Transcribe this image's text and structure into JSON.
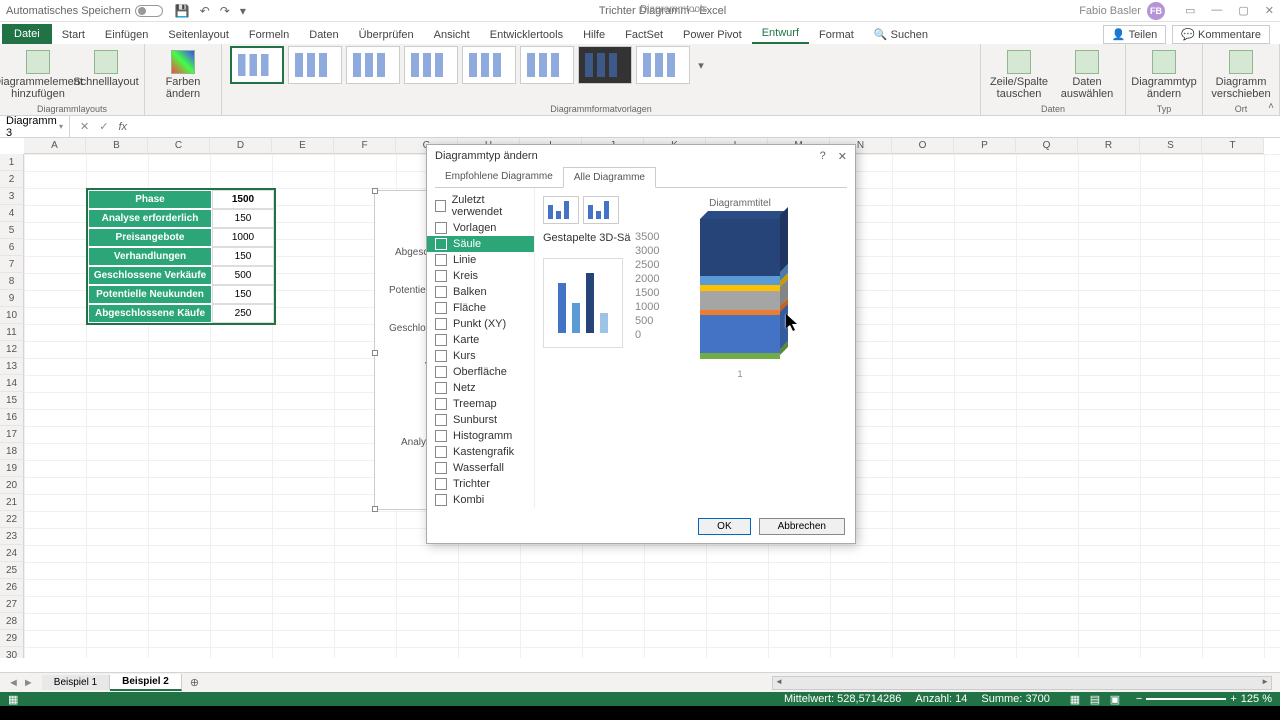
{
  "titlebar": {
    "autosave": "Automatisches Speichern",
    "doc_title": "Trichter Diagramm - Excel",
    "context_tools": "Diagrammtools",
    "user_name": "Fabio Basler",
    "user_initials": "FB"
  },
  "tabs": {
    "file": "Datei",
    "items": [
      "Start",
      "Einfügen",
      "Seitenlayout",
      "Formeln",
      "Daten",
      "Überprüfen",
      "Ansicht",
      "Entwicklertools",
      "Hilfe",
      "FactSet",
      "Power Pivot",
      "Entwurf",
      "Format"
    ],
    "active": "Entwurf",
    "search": "Suchen",
    "share": "Teilen",
    "comments": "Kommentare"
  },
  "ribbon": {
    "layouts": {
      "add_element": "Diagrammelement hinzufügen",
      "quick": "Schnelllayout",
      "label": "Diagrammlayouts"
    },
    "colors": {
      "btn": "Farben ändern"
    },
    "styles_label": "Diagrammformatvorlagen",
    "data": {
      "switch": "Zeile/Spalte tauschen",
      "select": "Daten auswählen",
      "label": "Daten"
    },
    "type": {
      "change": "Diagrammtyp ändern",
      "label": "Typ"
    },
    "location": {
      "move": "Diagramm verschieben",
      "label": "Ort"
    }
  },
  "namebox": "Diagramm 3",
  "columns": [
    "A",
    "B",
    "C",
    "D",
    "E",
    "F",
    "G",
    "H",
    "I",
    "J",
    "K",
    "L",
    "M",
    "N",
    "O",
    "P",
    "Q",
    "R",
    "S",
    "T"
  ],
  "rows_count": 30,
  "data_table": {
    "header": [
      "Phase",
      "1500"
    ],
    "rows": [
      [
        "Analyse erforderlich",
        "150"
      ],
      [
        "Preisangebote",
        "1000"
      ],
      [
        "Verhandlungen",
        "150"
      ],
      [
        "Geschlossene Verkäufe",
        "500"
      ],
      [
        "Potentielle Neukunden",
        "150"
      ],
      [
        "Abgeschlossene Käufe",
        "250"
      ]
    ]
  },
  "chart_back_labels": [
    "Abgeschlossen",
    "Potentielle Neu",
    "Geschlossene V",
    "Verhand",
    "Preisa",
    "Analyse erfo"
  ],
  "dialog": {
    "title": "Diagrammtyp ändern",
    "help": "?",
    "tab_recommended": "Empfohlene Diagramme",
    "tab_all": "Alle Diagramme",
    "types": [
      "Zuletzt verwendet",
      "Vorlagen",
      "Säule",
      "Linie",
      "Kreis",
      "Balken",
      "Fläche",
      "Punkt (XY)",
      "Karte",
      "Kurs",
      "Oberfläche",
      "Netz",
      "Treemap",
      "Sunburst",
      "Histogramm",
      "Kastengrafik",
      "Wasserfall",
      "Trichter",
      "Kombi"
    ],
    "selected_type": "Säule",
    "subtype_name": "Gestapelte 3D-Sä",
    "preview_title": "Diagrammtitel",
    "axis_ticks": [
      "3500",
      "3000",
      "2500",
      "2000",
      "1500",
      "1000",
      "500",
      "0"
    ],
    "ok": "OK",
    "cancel": "Abbrechen"
  },
  "sheets": {
    "tabs": [
      "Beispiel 1",
      "Beispiel 2"
    ],
    "active": "Beispiel 2"
  },
  "status": {
    "avg_label": "Mittelwert:",
    "avg": "528,5714286",
    "count_label": "Anzahl:",
    "count": "14",
    "sum_label": "Summe:",
    "sum": "3700",
    "zoom": "125 %"
  },
  "chart_data": {
    "type": "bar",
    "title": "Diagrammtitel",
    "orientation": "stacked-3d-column",
    "categories": [
      "1"
    ],
    "series": [
      {
        "name": "Analyse erforderlich",
        "values": [
          150
        ],
        "color": "#70ad47"
      },
      {
        "name": "Preisangebote",
        "values": [
          1000
        ],
        "color": "#4472c4"
      },
      {
        "name": "Verhandlungen",
        "values": [
          150
        ],
        "color": "#ed7d31"
      },
      {
        "name": "Geschlossene Verkäufe",
        "values": [
          500
        ],
        "color": "#a5a5a5"
      },
      {
        "name": "Potentielle Neukunden",
        "values": [
          150
        ],
        "color": "#ffc000"
      },
      {
        "name": "Abgeschlossene Käufe",
        "values": [
          250
        ],
        "color": "#5b9bd5"
      },
      {
        "name": "Phase",
        "values": [
          1500
        ],
        "color": "#264478"
      }
    ],
    "ylim": [
      0,
      3500
    ],
    "ylabel": "",
    "xlabel": ""
  }
}
